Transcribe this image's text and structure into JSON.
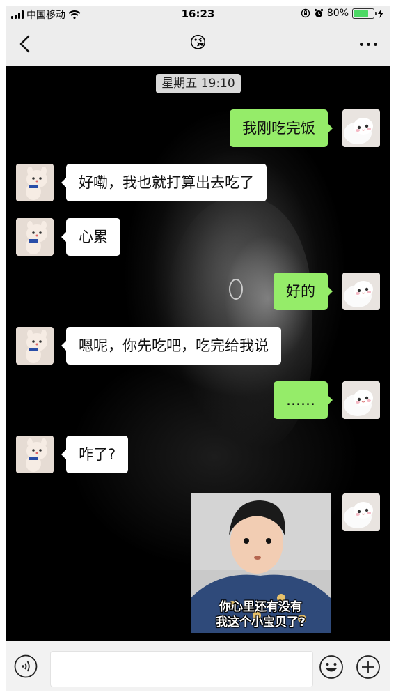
{
  "status_bar": {
    "carrier": "中国移动",
    "time": "16:23",
    "battery_percent": "80%",
    "battery_level": 0.8,
    "battery_color": "#4cd964"
  },
  "navbar": {
    "back_icon": "chevron-left-icon",
    "title_emoji": "😘",
    "more_icon": "more-dots-icon"
  },
  "chat": {
    "timestamp": "星期五 19:10",
    "messages": [
      {
        "side": "out",
        "text": "我刚吃完饭"
      },
      {
        "side": "in",
        "text": "好嘞，我也就打算出去吃了"
      },
      {
        "side": "in",
        "text": "心累"
      },
      {
        "side": "out",
        "text": "好的"
      },
      {
        "side": "in",
        "text": "嗯呢，你先吃吧，吃完给我说"
      },
      {
        "side": "out",
        "text": "……"
      },
      {
        "side": "in",
        "text": "咋了?"
      },
      {
        "side": "out",
        "type": "sticker",
        "caption_line1": "你心里还有没有",
        "caption_line2": "我这个小宝贝了?"
      }
    ],
    "outgoing_bubble_color": "#95ec69",
    "incoming_bubble_color": "#ffffff"
  },
  "input_bar": {
    "voice_icon": "voice-icon",
    "emoji_icon": "emoji-smile-icon",
    "add_icon": "plus-circle-icon",
    "text_value": ""
  }
}
